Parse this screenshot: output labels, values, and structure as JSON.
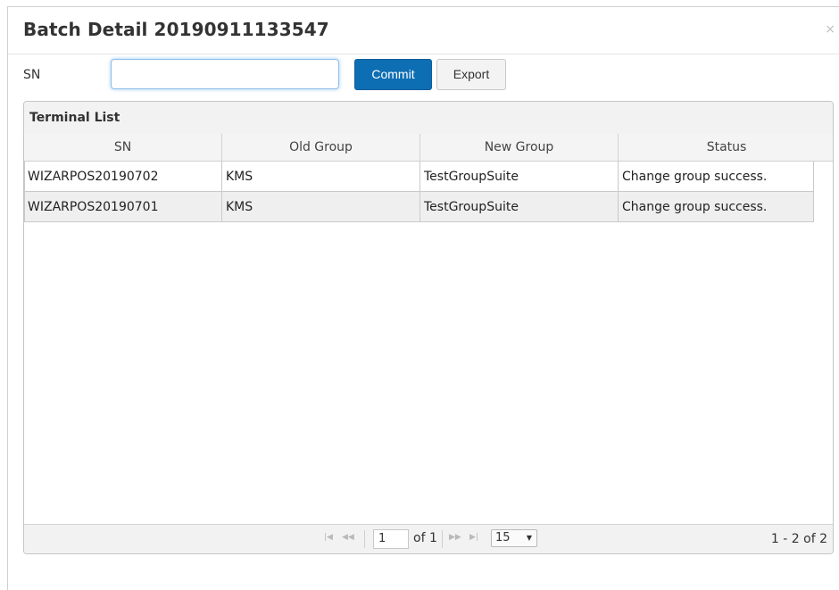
{
  "modal": {
    "title": "Batch Detail 20190911133547",
    "close_glyph": "×"
  },
  "search": {
    "label": "SN",
    "value": "",
    "placeholder": ""
  },
  "toolbar": {
    "commit_label": "Commit",
    "export_label": "Export"
  },
  "grid": {
    "caption": "Terminal List",
    "columns": [
      "SN",
      "Old Group",
      "New Group",
      "Status"
    ],
    "rows": [
      [
        "WIZARPOS20190702",
        "KMS",
        "TestGroupSuite",
        "Change group success."
      ],
      [
        "WIZARPOS20190701",
        "KMS",
        "TestGroupSuite",
        "Change group success."
      ]
    ]
  },
  "pager": {
    "page": "1",
    "of_label": "of 1",
    "page_size": "15",
    "count_label": "1 - 2 of 2",
    "icons": [
      "first-page-icon",
      "prev-page-icon",
      "next-page-icon",
      "last-page-icon"
    ]
  },
  "colors": {
    "primary": "#0e6eb3",
    "alt_row": "#efefef"
  }
}
